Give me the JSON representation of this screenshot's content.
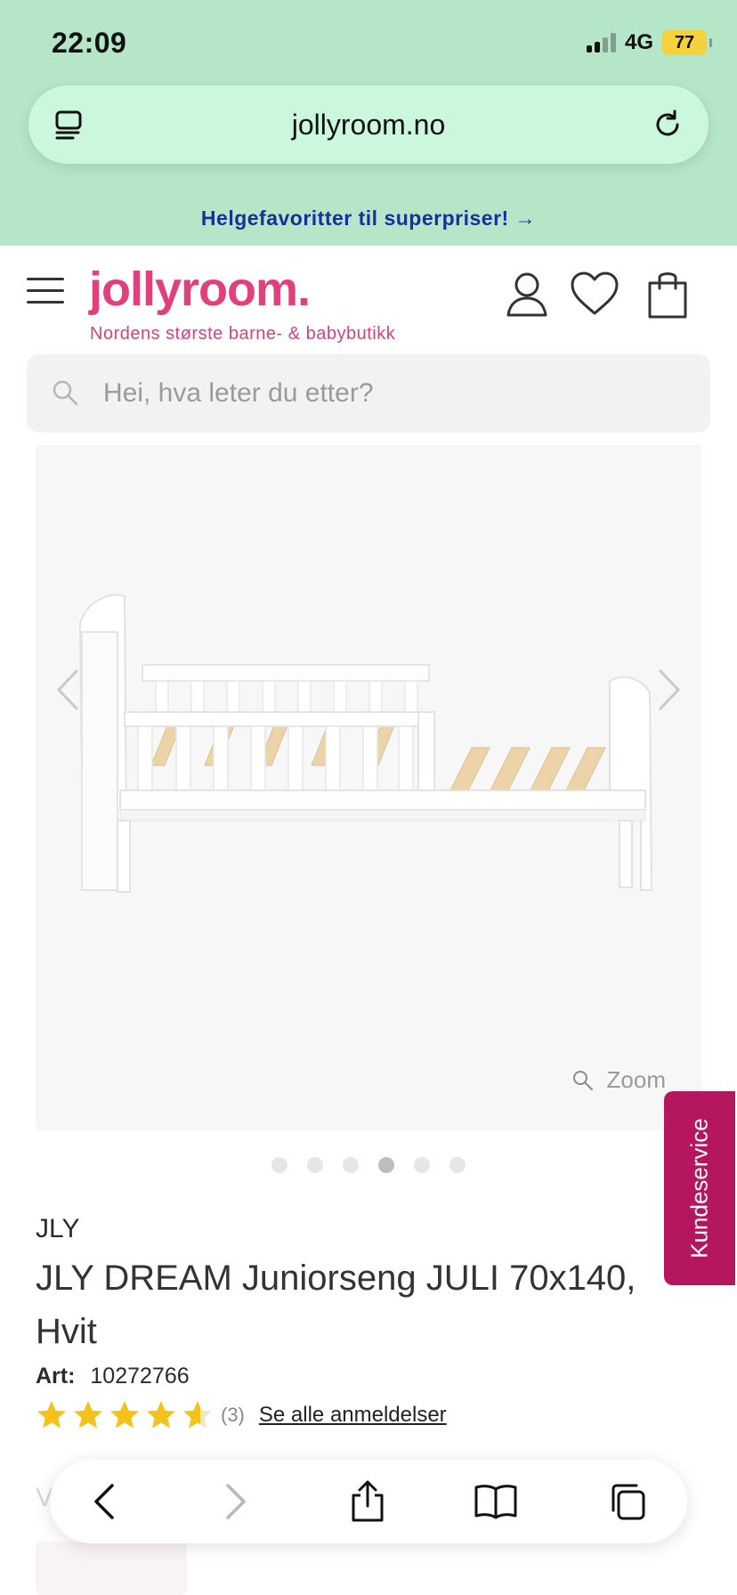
{
  "status_bar": {
    "time": "22:09",
    "network": "4G",
    "battery": "77"
  },
  "browser": {
    "url": "jollyroom.no"
  },
  "promo": {
    "text": "Helgefavoritter til superpriser! →"
  },
  "header": {
    "logo": "jollyroom.",
    "tagline": "Nordens største barne- & babybutikk"
  },
  "search": {
    "placeholder": "Hei, hva leter du etter?"
  },
  "gallery": {
    "zoom_label": "Zoom",
    "dot_count": 6,
    "active_dot": 4
  },
  "customer_service": {
    "label": "Kundeservice"
  },
  "product": {
    "brand": "JLY",
    "title": "JLY DREAM Juniorseng JULI 70x140, Hvit",
    "art_label": "Art:",
    "art_number": "10272766",
    "rating": 4.5,
    "review_count": "(3)",
    "reviews_link": "Se alle anmeldelser"
  },
  "colors": {
    "chrome_green": "#b5e6c8",
    "url_bar": "#cbf7dc",
    "brand_pink": "#e0407d",
    "customer_service": "#b5175e",
    "star_yellow": "#f5c21b",
    "promo_blue": "#1a2e9c"
  },
  "icons": {
    "tabs_overview": "reader-icon",
    "reload": "reload-icon",
    "menu": "hamburger-icon",
    "account": "user-icon",
    "wishlist": "heart-icon",
    "cart": "shopping-bag-icon",
    "search": "search-icon",
    "back": "chevron-left-icon",
    "forward": "chevron-right-icon",
    "share": "share-icon",
    "bookmarks": "book-icon",
    "tabs": "tabs-icon"
  }
}
